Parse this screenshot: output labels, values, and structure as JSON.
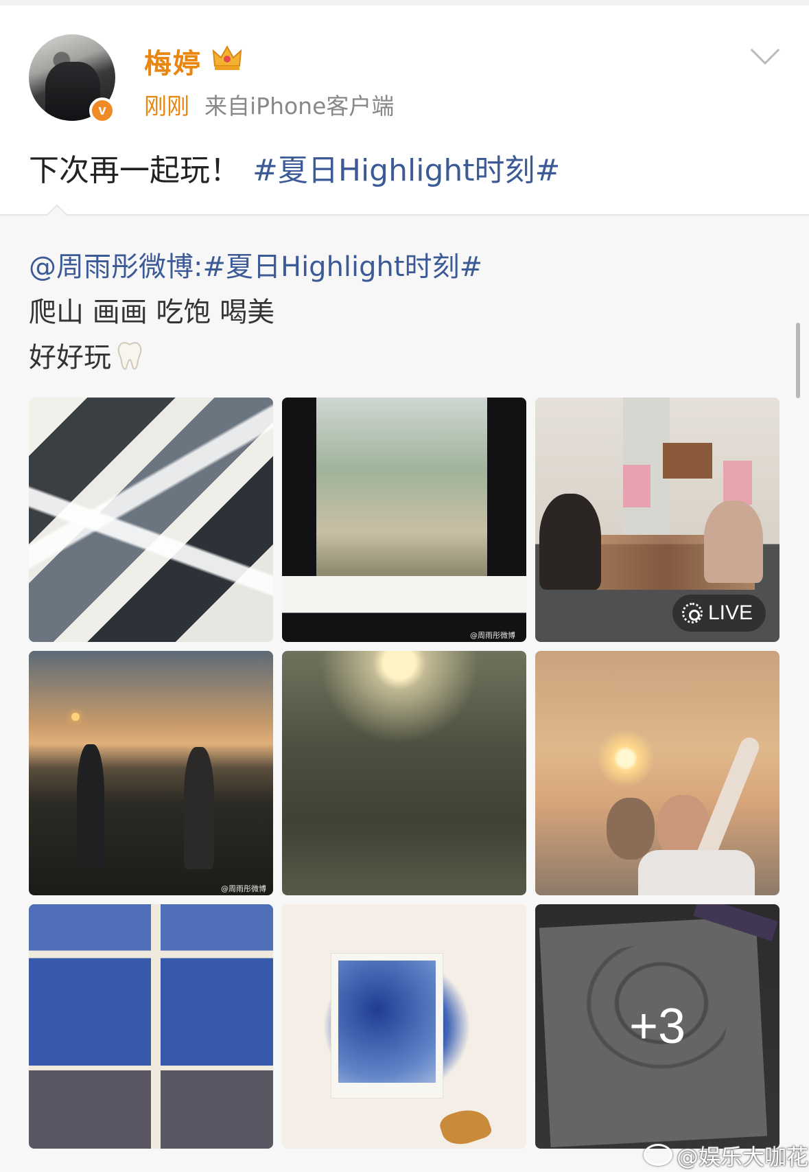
{
  "post": {
    "username": "梅婷",
    "time": "刚刚",
    "source": "来自iPhone客户端",
    "text": "下次再一起玩！",
    "hashtag": "#夏日Highlight时刻#"
  },
  "retweet": {
    "line1": "@周雨彤微博:#夏日Highlight时刻#",
    "line2": "爬山 画画 吃饱 喝美",
    "line3": "好好玩"
  },
  "grid": {
    "live_label": "LIVE",
    "more_count": "+3",
    "tile_watermark": "@周雨彤微博"
  },
  "watermark": "@娱乐大咖花",
  "colors": {
    "username": "#e8860f",
    "link": "#3c5a96",
    "verified_badge": "#f08a24"
  }
}
